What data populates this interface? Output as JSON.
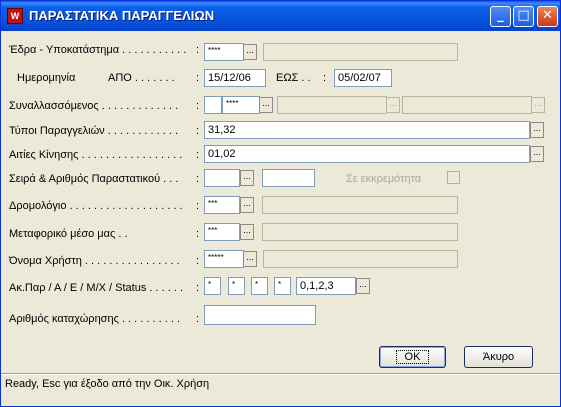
{
  "window": {
    "title": "ΠΑΡΑΣΤΑΤΙΚΑ ΠΑΡΑΓΓΕΛΙΩΝ",
    "minimize_glyph": "_",
    "maximize_glyph": "□",
    "close_glyph": "✕"
  },
  "form": {
    "edra_label": "Έδρα - Υποκατάστημα . . . . . . . . . . .",
    "edra_value": "****",
    "imerominia_label": "Ημερομηνία",
    "apo_label": "ΑΠΟ . . . . . . .",
    "apo_value": "15/12/06",
    "eos_label": "ΕΩΣ . .",
    "eos_value": "05/02/07",
    "synallassomenos_label": "Συναλλασσόμενος . . . . . . . . . . . . .",
    "synallassomenos_value": "****",
    "typoi_label": "Τύποι Παραγγελιών . . . . . . . . . . . .",
    "typoi_value": "31,32",
    "aities_label": "Αιτίες Κίνησης . . . . . . . . . . . . . . . . .",
    "aities_value": "01,02",
    "seira_label": "Σειρά & Αριθμός Παραστατικού . . .",
    "ekkremotita_label": "Σε εκκρεμότητα",
    "dromologio_label": "Δρομολόγιο . . . . . . . . . . . . . . . . . . .",
    "dromologio_value": "***",
    "metaforiko_label": "Μεταφορικό μέσο μας . .",
    "metaforiko_value": "***",
    "onoma_label": "Όνομα Χρήστη . . . . . . . . . . . . . . . .",
    "onoma_value": "*****",
    "akpar_label": "Ακ.Παρ / Α / Ε / Μ/Χ / Status . . . . . .",
    "akpar_v1": "*",
    "akpar_v2": "*",
    "akpar_v3": "*",
    "akpar_v4": "*",
    "status_value": "0,1,2,3",
    "arithmos_label": "Αριθμός καταχώρησης . . . . . . . . . .",
    "colon": ":",
    "ellipsis": "..."
  },
  "buttons": {
    "ok": "ΟΚ",
    "cancel": "Άκυρο"
  },
  "statusbar": {
    "text": "Ready, Esc για έξοδο από την Οικ. Χρήση"
  }
}
